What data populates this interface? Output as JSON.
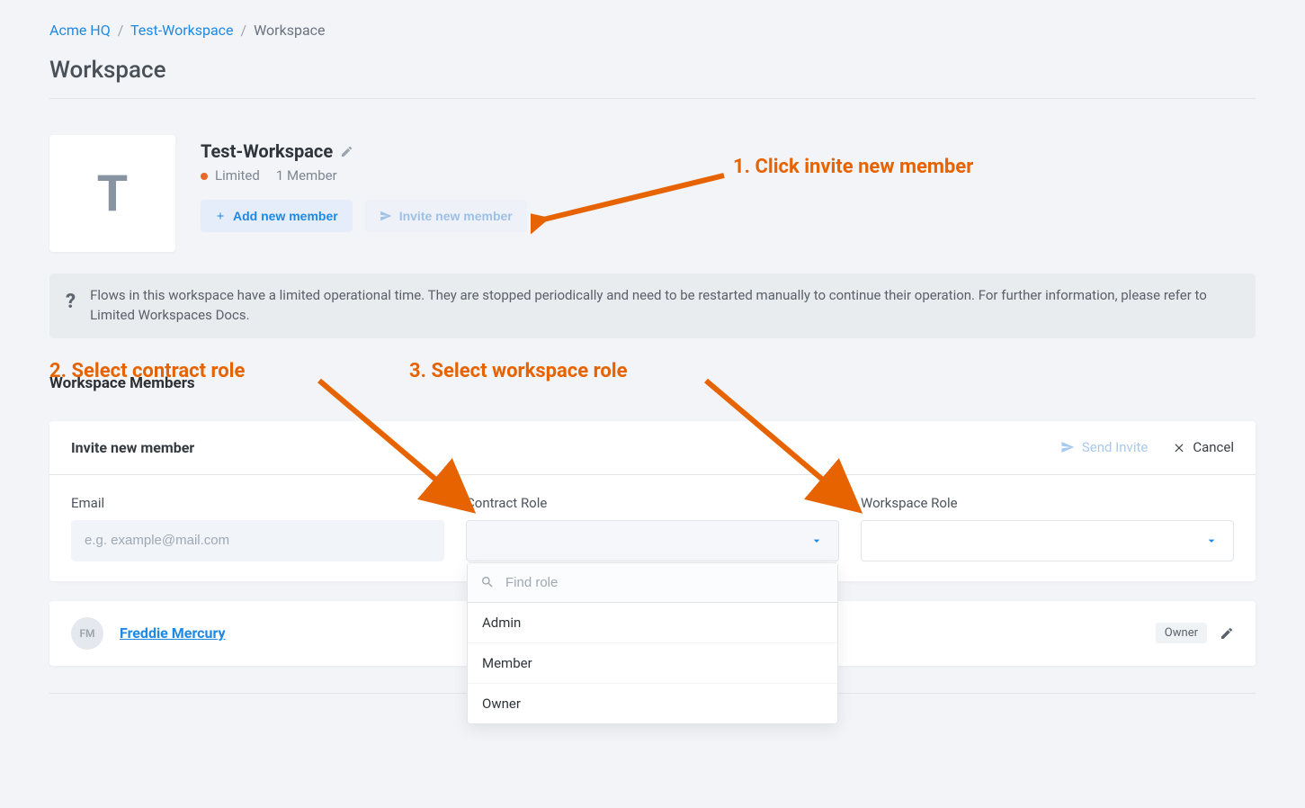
{
  "breadcrumb": {
    "org": "Acme HQ",
    "ws": "Test-Workspace",
    "current": "Workspace"
  },
  "page_title": "Workspace",
  "workspace": {
    "tile_letter": "T",
    "name": "Test-Workspace",
    "status": "Limited",
    "member_count": "1 Member",
    "add_btn": "Add new member",
    "invite_btn": "Invite new member"
  },
  "info_banner": "Flows in this workspace have a limited operational time. They are stopped periodically and need to be restarted manually to continue their operation. For further information, please refer to Limited Workspaces Docs.",
  "annotations": {
    "a1": "1. Click invite new member",
    "a2": "2. Select contract role",
    "a3": "3. Select workspace role"
  },
  "members_section": "Workspace Members",
  "invite_panel": {
    "title": "Invite new member",
    "send": "Send Invite",
    "cancel": "Cancel",
    "email_label": "Email",
    "email_placeholder": "e.g. example@mail.com",
    "contract_label": "Contract Role",
    "workspace_label": "Workspace Role",
    "find_placeholder": "Find role",
    "roles": [
      "Admin",
      "Member",
      "Owner"
    ]
  },
  "member_row": {
    "initials": "FM",
    "name": "Freddie Mercury",
    "role_tag": "Owner"
  }
}
